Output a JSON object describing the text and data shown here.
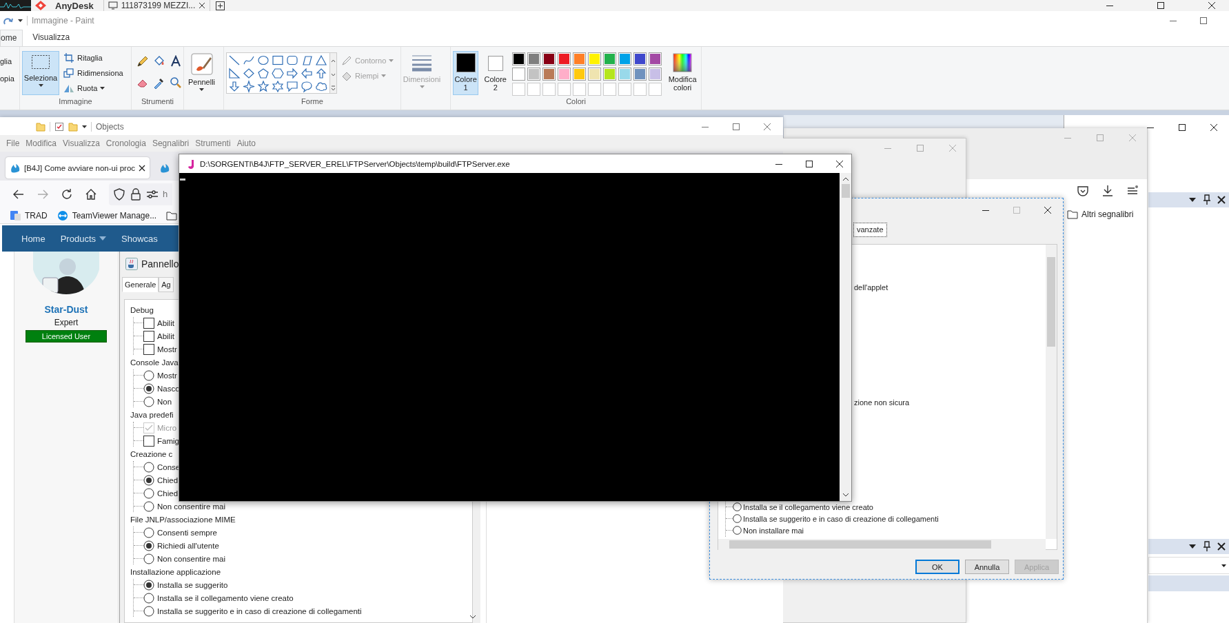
{
  "anydesk": {
    "app": "AnyDesk",
    "tabs": [
      {
        "label": "111873199 MEZZI..."
      }
    ]
  },
  "paint": {
    "title": "Immagine - Paint",
    "ribbon_tabs": [
      {
        "label": "ome",
        "selected": true
      },
      {
        "label": "Visualizza",
        "selected": false
      }
    ],
    "clipboard": [
      "glia",
      "opia"
    ],
    "image_group": {
      "label": "Immagine",
      "select_button": {
        "label": "Seleziona",
        "selected": true
      },
      "commands": [
        {
          "label": "Ritaglia",
          "dropdown": false
        },
        {
          "label": "Ridimensiona",
          "dropdown": false
        },
        {
          "label": "Ruota",
          "dropdown": true
        }
      ]
    },
    "tools_group": {
      "label": "Strumenti"
    },
    "brushes": {
      "label": "Pennelli"
    },
    "shapes_group": {
      "label": "Forme",
      "commands": [
        {
          "label": "Contorno",
          "disabled": true
        },
        {
          "label": "Riempi",
          "disabled": true
        }
      ]
    },
    "size": {
      "label": "Dimensioni",
      "disabled": true
    },
    "colors_group": {
      "label": "Colori",
      "color1": {
        "label": "Colore",
        "number": "1",
        "selected": true,
        "color": "#000000"
      },
      "color2": {
        "label": "Colore",
        "number": "2",
        "selected": false,
        "color": "#ffffff"
      },
      "palette": [
        {
          "color": "#000000"
        },
        {
          "color": "#7f7f7f"
        },
        {
          "color": "#880015"
        },
        {
          "color": "#ed1c24"
        },
        {
          "color": "#ff7f27"
        },
        {
          "color": "#fff200"
        },
        {
          "color": "#22b14c"
        },
        {
          "color": "#00a2e8"
        },
        {
          "color": "#3f48cc"
        },
        {
          "color": "#a349a4"
        },
        {
          "color": "#ffffff"
        },
        {
          "color": "#c3c3c3"
        },
        {
          "color": "#b97a57"
        },
        {
          "color": "#ffaec9"
        },
        {
          "color": "#ffc90e"
        },
        {
          "color": "#efe4b0"
        },
        {
          "color": "#b5e61d"
        },
        {
          "color": "#99d9ea"
        },
        {
          "color": "#7092be"
        },
        {
          "color": "#c8bfe7"
        }
      ],
      "edit_colors": {
        "line1": "Modifica",
        "line2": "colori"
      }
    }
  },
  "explorer": {
    "title": "Objects"
  },
  "browser": {
    "menu": [
      "File",
      "Modifica",
      "Visualizza",
      "Cronologia",
      "Segnalibri",
      "Strumenti",
      "Aiuto"
    ],
    "tabs": [
      {
        "label": "[B4J] Come avviare non-ui proc"
      }
    ],
    "address_fragment": "h",
    "bookmarks": [
      "TRAD",
      "TeamViewer Manage..."
    ],
    "site_nav": [
      {
        "label": "Home",
        "dropdown": false
      },
      {
        "label": "Products",
        "dropdown": true
      },
      {
        "label": "Showcas",
        "dropdown": false
      }
    ],
    "profile": {
      "name": "Star-Dust",
      "rank": "Expert",
      "badge": "Licensed User"
    }
  },
  "java_panel": {
    "title": "Pannello",
    "tabs": [
      {
        "label": "Generale",
        "selected": true
      },
      {
        "label": "Ag",
        "selected": false
      }
    ],
    "tree": [
      {
        "label": "Debug",
        "children": [
          {
            "label": "Abilit",
            "kind": "checkbox",
            "checked": false,
            "disabled": false
          },
          {
            "label": "Abilit",
            "kind": "checkbox",
            "checked": false,
            "disabled": false
          },
          {
            "label": "Mostr",
            "kind": "checkbox",
            "checked": false,
            "disabled": false
          }
        ]
      },
      {
        "label": "Console Java",
        "children": [
          {
            "label": "Mostr",
            "kind": "radio",
            "selected": false,
            "disabled": false
          },
          {
            "label": "Nasco",
            "kind": "radio",
            "selected": true,
            "disabled": false
          },
          {
            "label": "Non",
            "kind": "radio",
            "selected": false,
            "disabled": false
          }
        ]
      },
      {
        "label": "Java predefi",
        "children": [
          {
            "label": "Micro",
            "kind": "checkbox",
            "checked": true,
            "disabled": true
          },
          {
            "label": "Famig",
            "kind": "checkbox",
            "checked": false,
            "disabled": false
          }
        ]
      },
      {
        "label": "Creazione c",
        "children": [
          {
            "label": "Conse",
            "kind": "radio",
            "selected": false,
            "disabled": false
          },
          {
            "label": "Chied",
            "kind": "radio",
            "selected": true,
            "disabled": false
          },
          {
            "label": "Chied",
            "kind": "radio",
            "selected": false,
            "disabled": false
          },
          {
            "label": "Non consentire mai",
            "kind": "radio",
            "selected": false,
            "disabled": false
          }
        ]
      },
      {
        "label": "File JNLP/associazione MIME",
        "children": [
          {
            "label": "Consenti sempre",
            "kind": "radio",
            "selected": false,
            "disabled": false
          },
          {
            "label": "Richiedi all'utente",
            "kind": "radio",
            "selected": true,
            "disabled": false
          },
          {
            "label": "Non consentire mai",
            "kind": "radio",
            "selected": false,
            "disabled": false
          }
        ]
      },
      {
        "label": "Installazione applicazione",
        "children": [
          {
            "label": "Installa se suggerito",
            "kind": "radio",
            "selected": true,
            "disabled": false
          },
          {
            "label": "Installa se il collegamento viene creato",
            "kind": "radio",
            "selected": false,
            "disabled": false
          },
          {
            "label": "Installa se suggerito e in caso di creazione di collegamenti",
            "kind": "radio",
            "selected": false,
            "disabled": false
          }
        ]
      }
    ]
  },
  "console": {
    "title": "D:\\SORGENTI\\B4J\\FTP_SERVER_EREL\\FTPServer\\Objects\\temp\\build\\FTPServer.exe"
  },
  "java_dialog": {
    "tab": {
      "label": "vanzate",
      "selected": true
    },
    "texts": [
      "dell'applet",
      "zione non sicura"
    ],
    "options": [
      {
        "label": "Installa se il collegamento viene creato",
        "selected": false
      },
      {
        "label": "Installa se suggerito e in caso di creazione di collegamenti",
        "selected": false
      },
      {
        "label": "Non installare mai",
        "selected": false
      }
    ],
    "buttons": [
      {
        "label": "OK",
        "default": true,
        "disabled": false
      },
      {
        "label": "Annulla",
        "default": false,
        "disabled": false
      },
      {
        "label": "Applica",
        "default": false,
        "disabled": true
      }
    ]
  },
  "browser_back": {
    "bookmark_folder": "Altri segnalibri"
  }
}
